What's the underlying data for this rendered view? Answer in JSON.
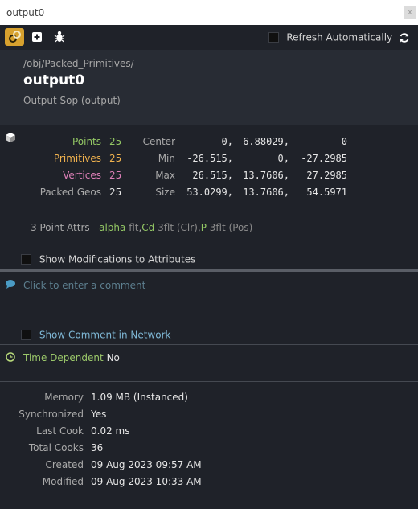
{
  "window": {
    "title": "output0",
    "close_glyph": "x"
  },
  "toolbar": {
    "refresh_label": "Refresh Automatically"
  },
  "header": {
    "path": "/obj/Packed_Primitives/",
    "node_name": "output0",
    "node_type": "Output Sop (output)"
  },
  "counts": [
    {
      "label": "Points",
      "value": "25",
      "color": "#93c764"
    },
    {
      "label": "Primitives",
      "value": "25",
      "color": "#f0b24e"
    },
    {
      "label": "Vertices",
      "value": "25",
      "color": "#dd7fb7"
    },
    {
      "label": "Packed Geos",
      "value": "25",
      "color": "#a9a9a9"
    }
  ],
  "bounds": [
    {
      "label": "Center",
      "values": [
        "0,",
        "6.88029,",
        "0"
      ]
    },
    {
      "label": "Min",
      "values": [
        "-26.515,",
        "0,",
        "-27.2985"
      ]
    },
    {
      "label": "Max",
      "values": [
        "26.515,",
        "13.7606,",
        "27.2985"
      ]
    },
    {
      "label": "Size",
      "values": [
        "53.0299,",
        "13.7606,",
        "54.5971"
      ]
    }
  ],
  "point_attrs": {
    "label": "3 Point Attrs",
    "items": [
      {
        "name": "alpha",
        "type": "flt",
        "qual": "",
        "sep": ","
      },
      {
        "name": "Cd",
        "type": "3flt",
        "qual": "(Clr)",
        "sep": ","
      },
      {
        "name": "P",
        "type": "3flt",
        "qual": "(Pos)",
        "sep": ""
      }
    ]
  },
  "show_modifications_label": "Show Modifications to Attributes",
  "comment_placeholder": "Click to enter a comment",
  "show_comment_label": "Show Comment in Network",
  "time_dependent": {
    "label": "Time Dependent",
    "value": "No"
  },
  "meta": [
    {
      "label": "Memory",
      "value": "1.09 MB (Instanced)"
    },
    {
      "label": "Synchronized",
      "value": "Yes"
    },
    {
      "label": "Last Cook",
      "value": "0.02 ms"
    },
    {
      "label": "Total Cooks",
      "value": "36"
    },
    {
      "label": "Created",
      "value": "09 Aug 2023 09:57 AM"
    },
    {
      "label": "Modified",
      "value": "09 Aug 2023 10:33 AM"
    }
  ]
}
